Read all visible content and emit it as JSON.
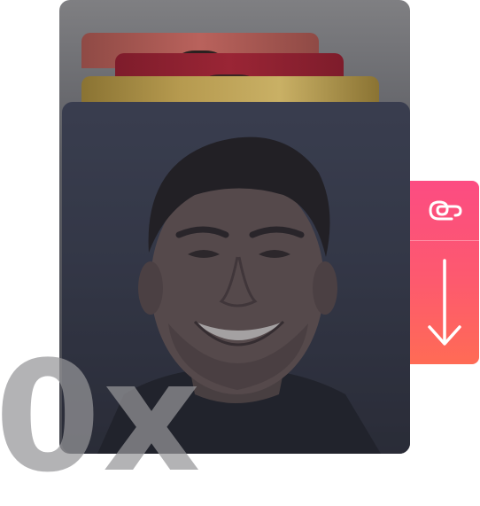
{
  "watermark": {
    "text": "0x"
  },
  "toolbar": {
    "top_icon": "link-loop-icon",
    "bottom_icon": "arrow-down-icon"
  },
  "colors": {
    "toolbar_top": "#fc4c82",
    "toolbar_bottom": "#ff6b55",
    "overlay": "#45464e"
  },
  "cards": [
    {
      "name": "back-card-red",
      "color": "#b9625c"
    },
    {
      "name": "back-card-crimson",
      "color": "#9a2535"
    },
    {
      "name": "back-card-gold",
      "color": "#c9b065"
    },
    {
      "name": "front-card-portrait",
      "color": "#43485c"
    }
  ]
}
